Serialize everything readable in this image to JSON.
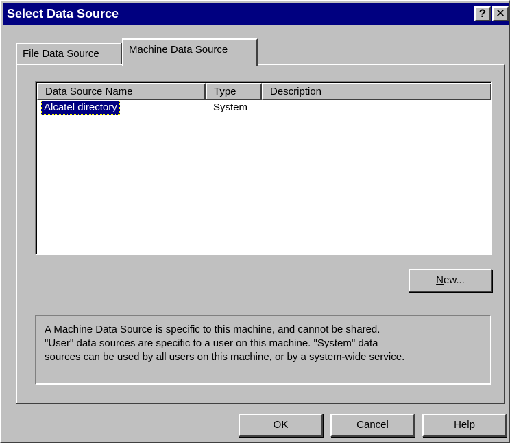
{
  "window": {
    "title": "Select Data Source",
    "help_button": "?",
    "close_button": "✕"
  },
  "tabs": [
    {
      "label": "File Data Source",
      "selected": false
    },
    {
      "label": "Machine Data Source",
      "selected": true
    }
  ],
  "list": {
    "columns": [
      "Data Source Name",
      "Type",
      "Description"
    ],
    "rows": [
      {
        "name": "Alcatel directory",
        "type": "System",
        "description": "",
        "selected": true
      }
    ]
  },
  "buttons": {
    "new_mnemonic": "N",
    "new_rest": "ew...",
    "ok": "OK",
    "cancel": "Cancel",
    "help": "Help"
  },
  "info": {
    "lines": [
      "A Machine Data Source is specific to this machine, and cannot be shared.",
      "\"User\" data sources are specific to a user on this machine.  \"System\" data",
      "sources can be used by all users on this machine, or by a system-wide service."
    ]
  },
  "colors": {
    "titlebar": "#000080",
    "face": "#c0c0c0",
    "selection": "#000080"
  }
}
